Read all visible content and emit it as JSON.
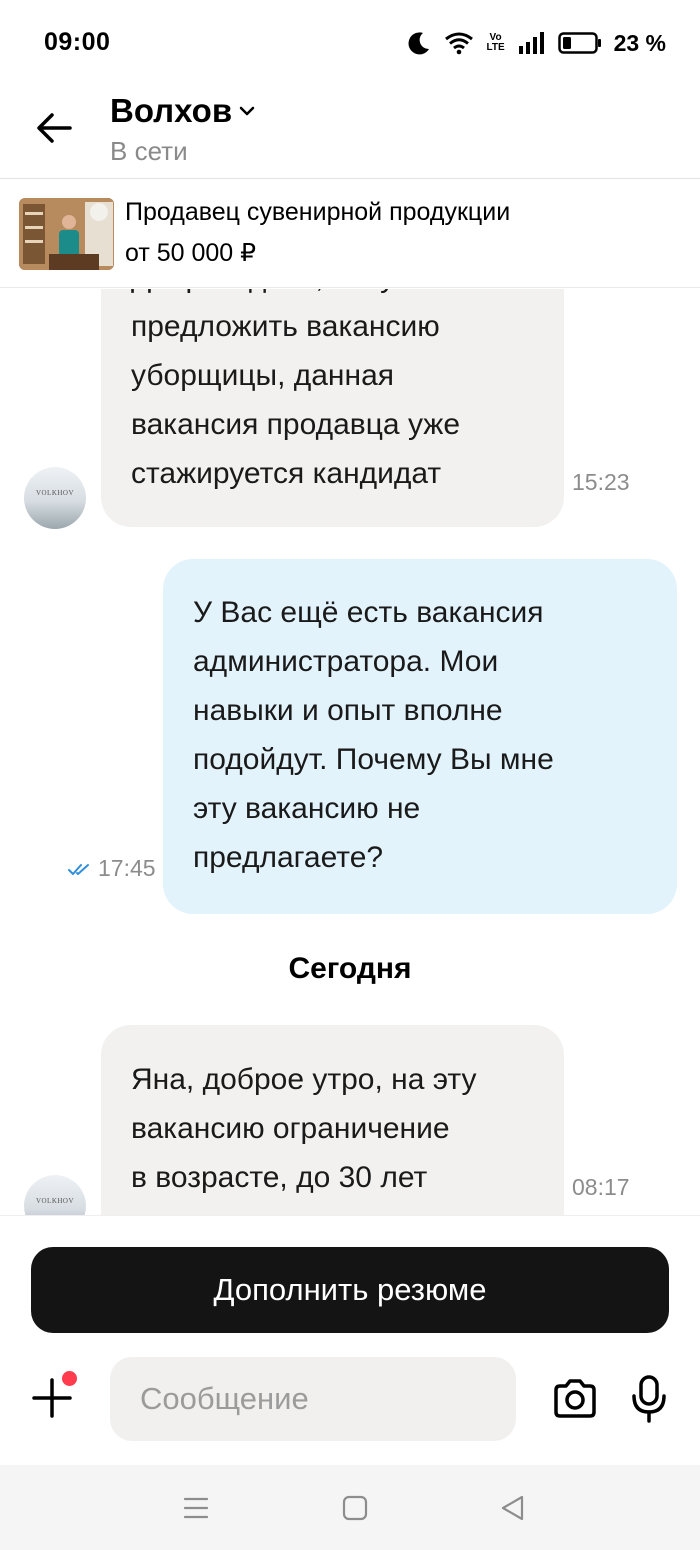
{
  "status_bar": {
    "time": "09:00",
    "volte": "Vo LTE",
    "battery": "23 %"
  },
  "header": {
    "title": "Волхов",
    "status": "В сети"
  },
  "vacancy": {
    "title": "Продавец сувенирной продукции",
    "salary": "от 50 000 ₽"
  },
  "messages": [
    {
      "direction": "incoming",
      "lines": [
        "Добрый день, могу",
        "предложить вакансию",
        "уборщицы, данная",
        "вакансия продавца уже",
        "стажируется кандидат"
      ],
      "time": "15:23",
      "avatar_text": "VOLKHOV"
    },
    {
      "direction": "outgoing",
      "lines": [
        "У Вас ещё есть вакансия",
        "администратора. Мои",
        "навыки и опыт вполне",
        "подойдут. Почему Вы мне",
        "эту вакансию не",
        "предлагаете?"
      ],
      "time": "17:45",
      "read": true
    },
    {
      "direction": "incoming",
      "lines": [
        "Яна, доброе утро, на эту",
        "вакансию ограничение",
        "в возрасте, до 30 лет"
      ],
      "time": "08:17",
      "avatar_text": "VOLKHOV"
    }
  ],
  "date_divider": "Сегодня",
  "composer": {
    "cta_label": "Дополнить резюме",
    "placeholder": "Сообщение",
    "plus_badge_color": "#ff3b4d"
  },
  "icons": [
    "back-arrow-icon",
    "chevron-down-icon",
    "moon-icon",
    "wifi-icon",
    "signal-icon",
    "battery-icon",
    "double-check-icon",
    "plus-icon",
    "camera-icon",
    "microphone-icon",
    "menu-icon",
    "home-icon",
    "back-triangle-icon"
  ],
  "colors": {
    "incoming_bubble": "#f2f1f0",
    "outgoing_bubble": "#e3f3fc",
    "cta_background": "#141414",
    "read_check": "#2f8fdc"
  }
}
